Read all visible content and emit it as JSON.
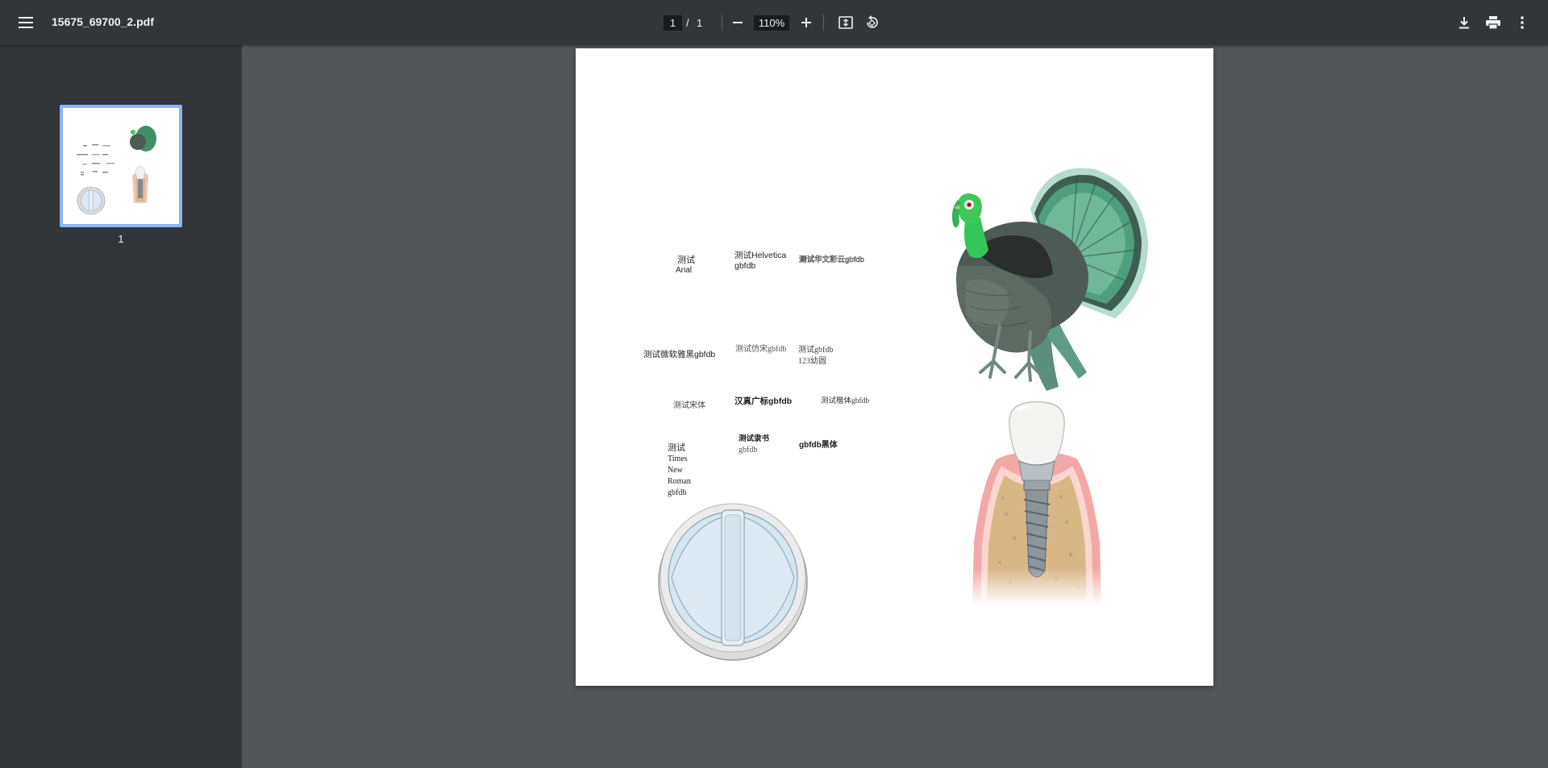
{
  "toolbar": {
    "filename": "15675_69700_2.pdf",
    "page_current": "1",
    "page_separator": "/",
    "page_total": "1",
    "zoom": "110%",
    "icons": [
      "menu-icon",
      "zoom-out-icon",
      "zoom-in-icon",
      "fit-page-icon",
      "rotate-icon",
      "download-icon",
      "print-icon",
      "more-vert-icon"
    ]
  },
  "sidebar": {
    "thumbnails": [
      {
        "label": "1",
        "selected": true
      }
    ]
  },
  "document": {
    "texts": {
      "arial_1": "测试",
      "arial_2": "Arial",
      "helvetica_1": "测试Helvetica",
      "helvetica_2": "gbfdb",
      "huawen": "测试华文彩云gbfdb",
      "yahei": "测试微软雅黑gbfdb",
      "fangsong": "测试仿宋gbfdb",
      "youyuan_1": "测试gbfdb",
      "youyuan_2": "123幼圆",
      "songti": "测试宋体",
      "hanzhen": "汉真广标gbfdb",
      "kaiti": "测试楷体gbfdb",
      "lishu_1": "测试隶书",
      "lishu_2": "gbfdb",
      "heiti": "gbfdb黑体",
      "tnr_1": "测试",
      "tnr_2": "Times",
      "tnr_3": "New",
      "tnr_4": "Roman",
      "tnr_5": "gbfdb"
    },
    "illustrations": [
      "turkey-illustration",
      "dental-implant-illustration",
      "round-window-illustration"
    ]
  },
  "colors": {
    "toolbar_bg": "#323639",
    "sidebar_bg": "#323639",
    "viewer_bg": "#525659",
    "thumb_selected_border": "#8ab4f8"
  }
}
